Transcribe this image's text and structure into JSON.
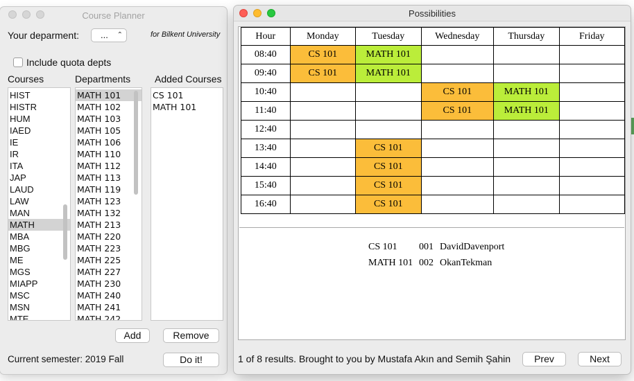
{
  "planner": {
    "title": "Course Planner",
    "dept_label": "Your deparment:",
    "dept_value": "...",
    "university_note": "for Bilkent University",
    "include_quota_label": "Include quota depts",
    "include_quota_checked": false,
    "courses_header": "Courses",
    "departments_header": "Departments",
    "added_header": "Added Courses",
    "courses": [
      "HIST",
      "HISTR",
      "HUM",
      "IAED",
      "IE",
      "IR",
      "ITA",
      "JAP",
      "LAUD",
      "LAW",
      "MAN",
      "MATH",
      "MBA",
      "MBG",
      "ME",
      "MGS",
      "MIAPP",
      "MSC",
      "MSN",
      "MTE"
    ],
    "selected_course": "MATH",
    "departments": [
      "MATH 101",
      "MATH 102",
      "MATH 103",
      "MATH 105",
      "MATH 106",
      "MATH 110",
      "MATH 112",
      "MATH 113",
      "MATH 119",
      "MATH 123",
      "MATH 132",
      "MATH 213",
      "MATH 220",
      "MATH 223",
      "MATH 225",
      "MATH 227",
      "MATH 230",
      "MATH 240",
      "MATH 241",
      "MATH 242"
    ],
    "selected_department": "MATH 101",
    "added_courses": [
      "CS 101",
      "MATH 101"
    ],
    "add_label": "Add",
    "remove_label": "Remove",
    "semester_text": "Current semester: 2019 Fall",
    "doit_label": "Do it!"
  },
  "possibilities": {
    "title": "Possibilities",
    "headers": [
      "Hour",
      "Monday",
      "Tuesday",
      "Wednesday",
      "Thursday",
      "Friday"
    ],
    "rows": [
      {
        "hour": "08:40",
        "cells": [
          "CS 101",
          "MATH 101",
          "",
          "",
          ""
        ]
      },
      {
        "hour": "09:40",
        "cells": [
          "CS 101",
          "MATH 101",
          "",
          "",
          ""
        ]
      },
      {
        "hour": "10:40",
        "cells": [
          "",
          "",
          "CS 101",
          "MATH 101",
          ""
        ]
      },
      {
        "hour": "11:40",
        "cells": [
          "",
          "",
          "CS 101",
          "MATH 101",
          ""
        ]
      },
      {
        "hour": "12:40",
        "cells": [
          "",
          "",
          "",
          "",
          ""
        ]
      },
      {
        "hour": "13:40",
        "cells": [
          "",
          "CS 101",
          "",
          "",
          ""
        ]
      },
      {
        "hour": "14:40",
        "cells": [
          "",
          "CS 101",
          "",
          "",
          ""
        ]
      },
      {
        "hour": "15:40",
        "cells": [
          "",
          "CS 101",
          "",
          "",
          ""
        ]
      },
      {
        "hour": "16:40",
        "cells": [
          "",
          "CS 101",
          "",
          "",
          ""
        ]
      }
    ],
    "course_colors": {
      "CS 101": "#fbbd3a",
      "MATH 101": "#bbed3a"
    },
    "sections": [
      {
        "course": "CS 101",
        "section": "001",
        "instructor": "DavidDavenport"
      },
      {
        "course": "MATH 101",
        "section": "002",
        "instructor": "OkanTekman"
      }
    ],
    "status_text": "1 of 8 results. Brought to you by Mustafa Akın and Semih Şahin",
    "prev_label": "Prev",
    "next_label": "Next"
  }
}
